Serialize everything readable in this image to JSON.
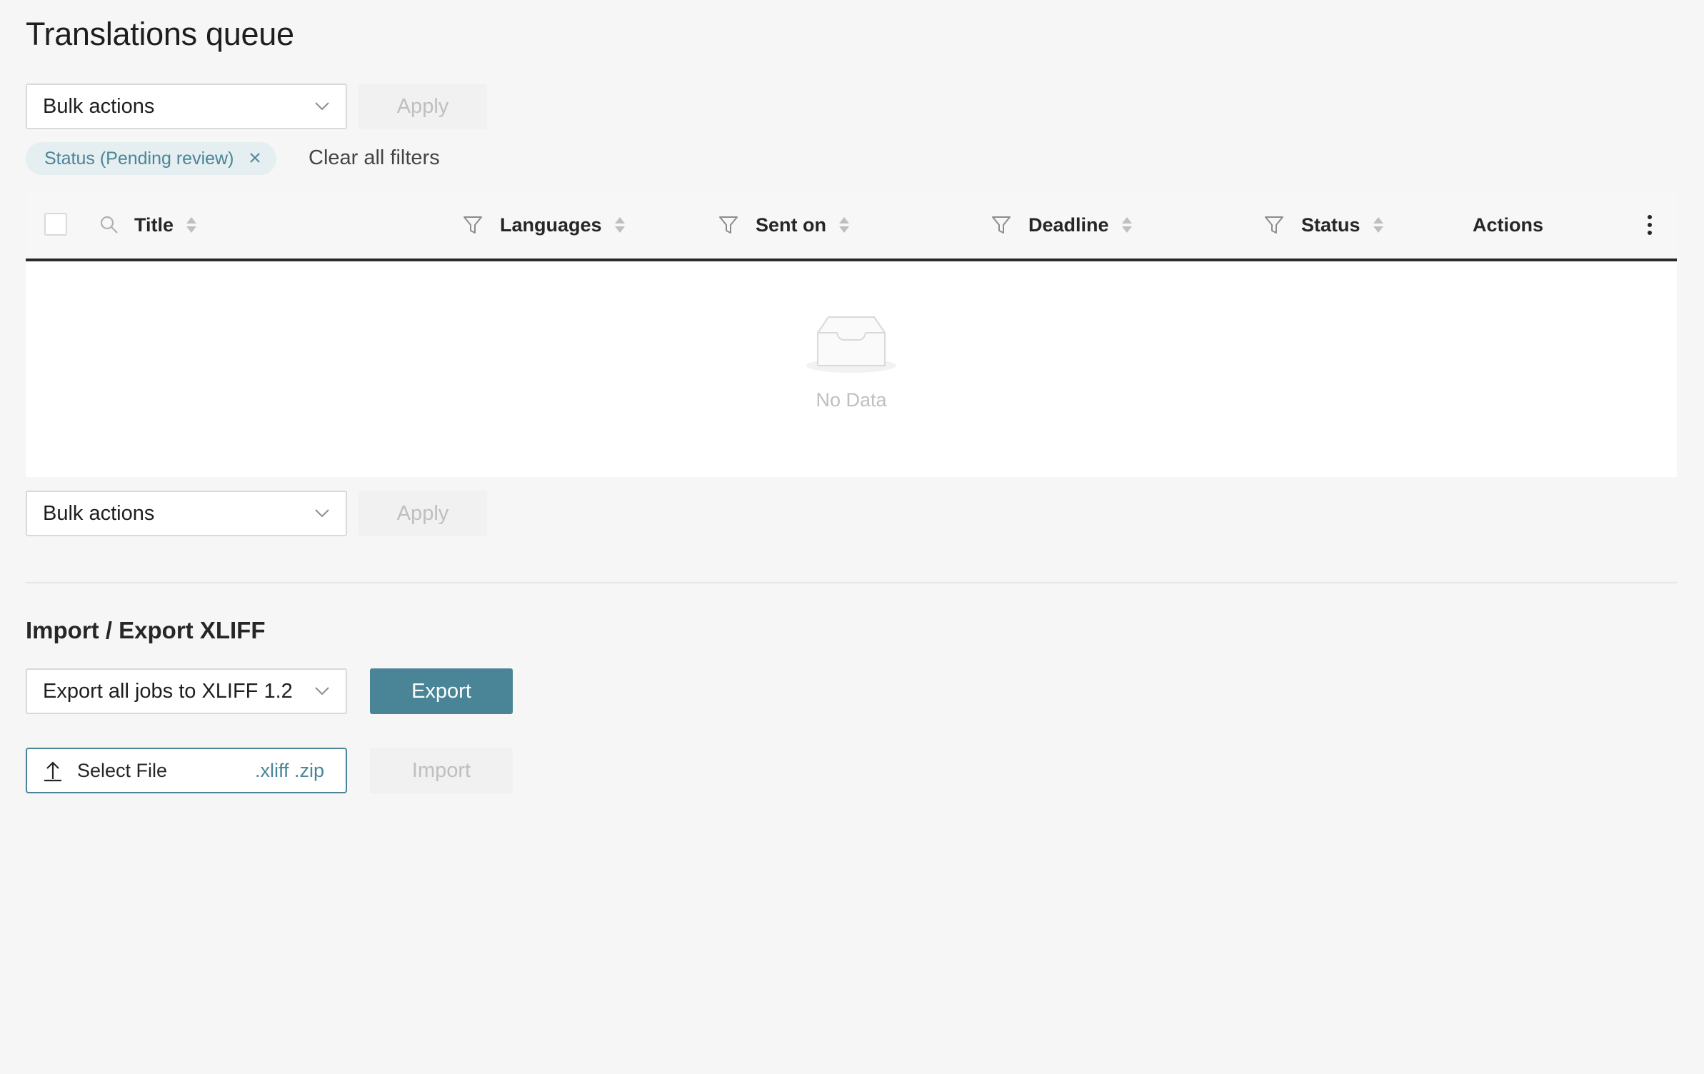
{
  "page": {
    "title": "Translations queue"
  },
  "bulk_top": {
    "selected": "Bulk actions",
    "apply_label": "Apply"
  },
  "filters": {
    "chips": [
      {
        "label": "Status (Pending review)"
      }
    ],
    "clear_label": "Clear all filters"
  },
  "table": {
    "columns": [
      {
        "label": "Title",
        "search": true,
        "filter": false,
        "sortable": true
      },
      {
        "label": "Languages",
        "filter": true,
        "sortable": true
      },
      {
        "label": "Sent on",
        "filter": true,
        "sortable": true
      },
      {
        "label": "Deadline",
        "filter": true,
        "sortable": true
      },
      {
        "label": "Status",
        "filter": true,
        "sortable": true
      },
      {
        "label": "Actions",
        "filter": false,
        "sortable": false
      }
    ],
    "empty_text": "No Data"
  },
  "bulk_bottom": {
    "selected": "Bulk actions",
    "apply_label": "Apply"
  },
  "import_export": {
    "title": "Import / Export XLIFF",
    "export_option": "Export all jobs to XLIFF 1.2",
    "export_label": "Export",
    "select_file_label": "Select File",
    "file_extensions": ".xliff .zip",
    "import_label": "Import"
  },
  "colors": {
    "accent": "#4a8597",
    "chip_bg": "#e5eef0",
    "page_bg": "#f5f6f5",
    "header_border": "#2a2a2a"
  }
}
